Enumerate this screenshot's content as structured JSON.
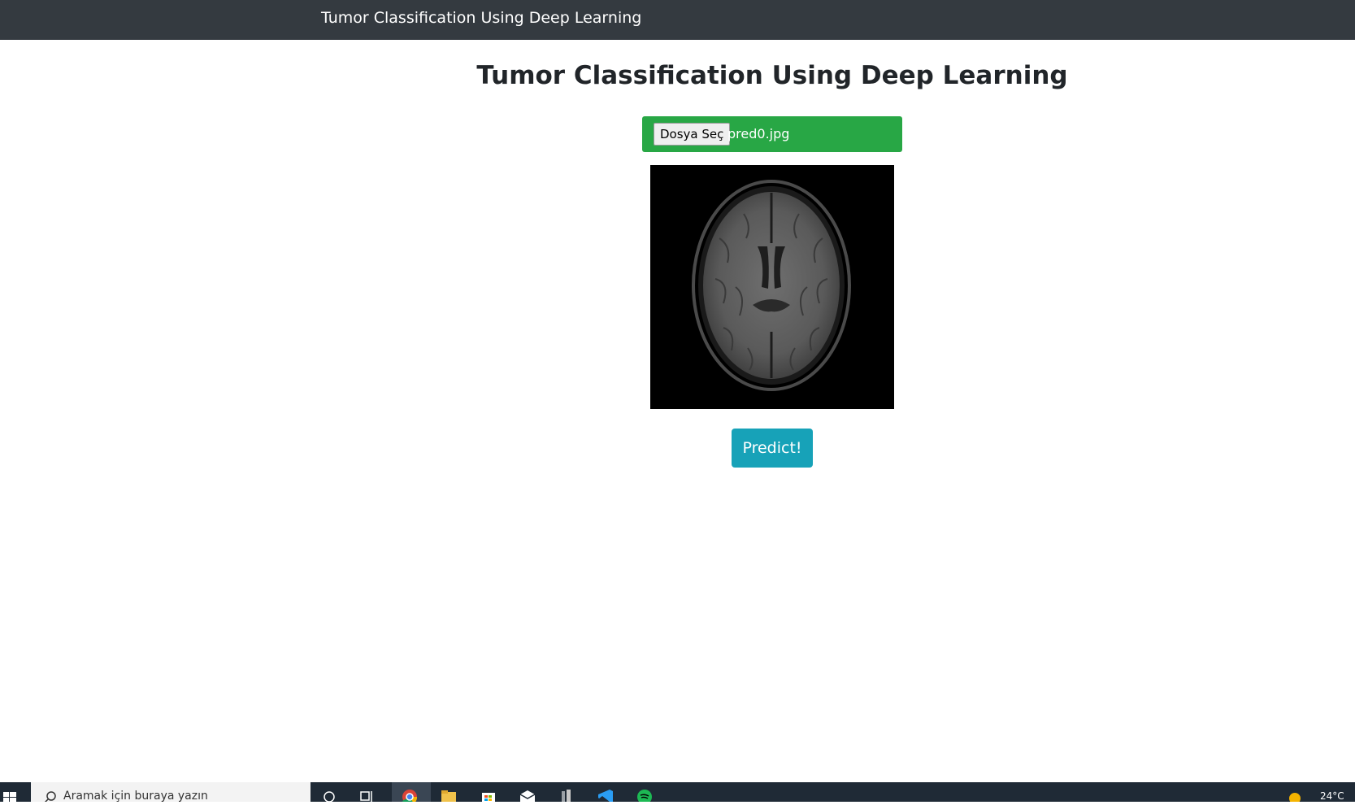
{
  "navbar": {
    "brand": "Tumor Classification Using Deep Learning"
  },
  "main": {
    "title": "Tumor Classification Using Deep Learning",
    "upload": {
      "button_label": "Dosya Seç",
      "file_name": "pred0.jpg"
    },
    "preview": {
      "description_icon": "brain-mri-image"
    },
    "predict_label": "Predict!"
  },
  "colors": {
    "navbar": "#343a40",
    "upload_bar": "#28a745",
    "predict_button": "#17a2b8"
  },
  "taskbar": {
    "search_placeholder": "Aramak için buraya yazın",
    "icons": [
      "windows-start-icon",
      "search-icon",
      "cortana-icon",
      "task-view-icon",
      "chrome-icon",
      "file-explorer-icon",
      "store-icon",
      "mail-icon",
      "app-icon",
      "vscode-icon",
      "spotify-icon",
      "weather-icon"
    ],
    "weather": "24°C"
  }
}
